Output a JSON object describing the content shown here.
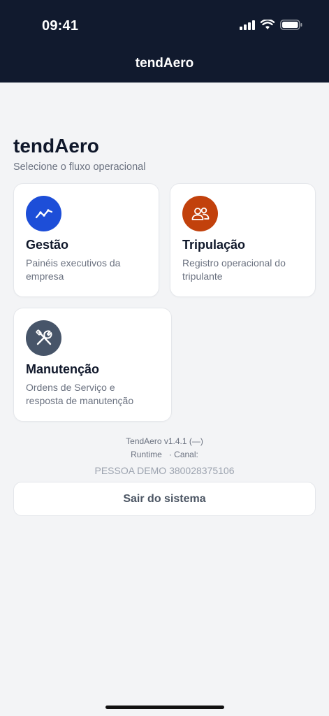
{
  "status_bar": {
    "time": "09:41",
    "icons": [
      "signal-icon",
      "wifi-icon",
      "battery-icon"
    ]
  },
  "header": {
    "title": "tendAero"
  },
  "main": {
    "title": "tendAero",
    "subtitle": "Selecione o fluxo operacional",
    "cards": [
      {
        "title": "Gestão",
        "description": "Painéis executivos da empresa",
        "icon": "chart-line-icon",
        "icon_color": "#1d4ed8"
      },
      {
        "title": "Tripulação",
        "description": "Registro operacional do tripulante",
        "icon": "users-icon",
        "icon_color": "#c2410c"
      },
      {
        "title": "Manutenção",
        "description": "Ordens de Serviço e resposta de manutenção",
        "icon": "tools-icon",
        "icon_color": "#475569"
      }
    ]
  },
  "footer": {
    "version": "TendAero v1.4.1 (—)",
    "runtime": "Runtime   · Canal:",
    "user": "PESSOA DEMO 380028375106",
    "logout_label": "Sair do sistema"
  },
  "colors": {
    "header_bg": "#111a2e",
    "page_bg": "#f3f4f6"
  }
}
